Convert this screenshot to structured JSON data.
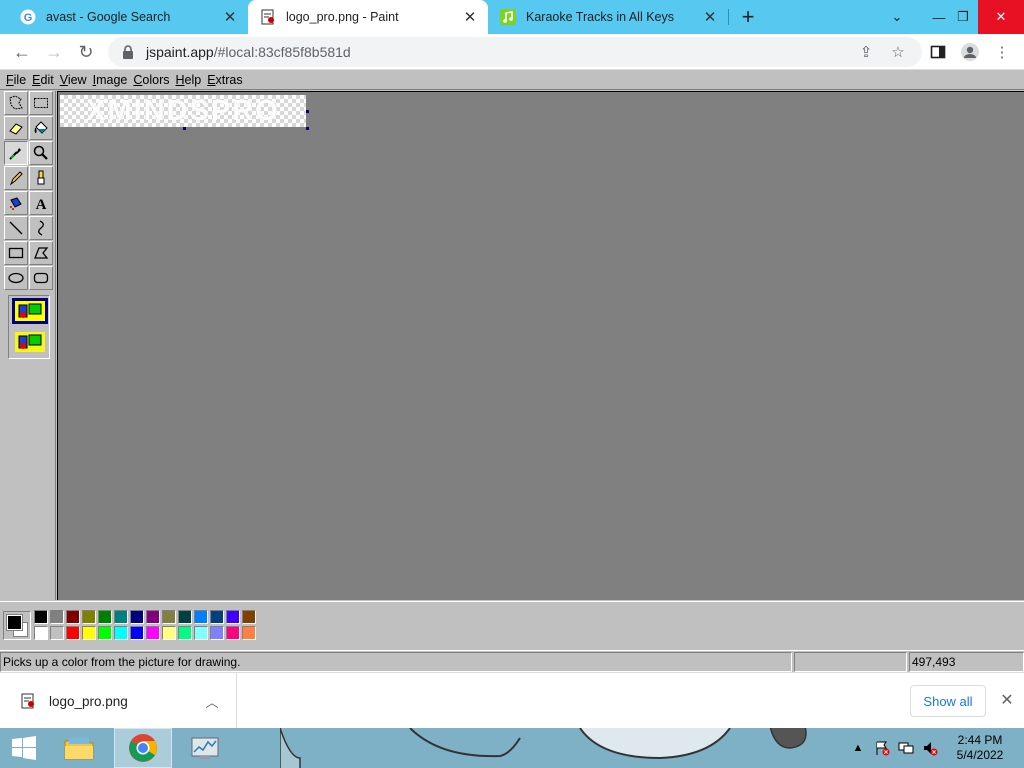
{
  "browser": {
    "tabs": [
      {
        "title": "avast - Google Search",
        "favicon": "google-g-icon",
        "active": false
      },
      {
        "title": "logo_pro.png - Paint",
        "favicon": "paint-icon",
        "active": true
      },
      {
        "title": "Karaoke Tracks in All Keys",
        "favicon": "music-note-icon",
        "active": false
      }
    ],
    "url_host": "jspaint.app",
    "url_path": "/#local:83cf85f8b581d",
    "colors": {
      "tabstrip": "#57c8f0",
      "close_button": "#e81123"
    }
  },
  "paint": {
    "menus": [
      {
        "label": "File",
        "accel": "F",
        "rest": "ile"
      },
      {
        "label": "Edit",
        "accel": "E",
        "rest": "dit"
      },
      {
        "label": "View",
        "accel": "V",
        "rest": "iew"
      },
      {
        "label": "Image",
        "accel": "I",
        "rest": "mage"
      },
      {
        "label": "Colors",
        "accel": "C",
        "rest": "olors"
      },
      {
        "label": "Help",
        "accel": "H",
        "rest": "elp"
      },
      {
        "label": "Extras",
        "accel": "E",
        "rest": "xtras"
      }
    ],
    "tools": [
      "free-form-select",
      "rectangle-select",
      "eraser",
      "fill-with-color",
      "pick-color",
      "magnifier",
      "pencil",
      "brush",
      "airbrush",
      "text",
      "line",
      "curve",
      "rectangle",
      "polygon",
      "ellipse",
      "rounded-rectangle"
    ],
    "selected_tool": "pick-color",
    "canvas_text": "XMINDSPRO",
    "foreground_color": "#000000",
    "background_color": "#ffffff",
    "palette": [
      "#000000",
      "#808080",
      "#800000",
      "#808000",
      "#008000",
      "#008080",
      "#000080",
      "#800080",
      "#808040",
      "#004040",
      "#0080ff",
      "#004080",
      "#4000ff",
      "#804000",
      "#ffffff",
      "#c0c0c0",
      "#ff0000",
      "#ffff00",
      "#00ff00",
      "#00ffff",
      "#0000ff",
      "#ff00ff",
      "#ffff80",
      "#00ff80",
      "#80ffff",
      "#8080ff",
      "#ff0080",
      "#ff8040"
    ],
    "status_text": "Picks up a color from the picture for drawing.",
    "status_size": "",
    "status_coords": "497,493"
  },
  "downloads": {
    "file_name": "logo_pro.png",
    "show_all": "Show all"
  },
  "taskbar": {
    "time": "2:44 PM",
    "date": "5/4/2022"
  }
}
